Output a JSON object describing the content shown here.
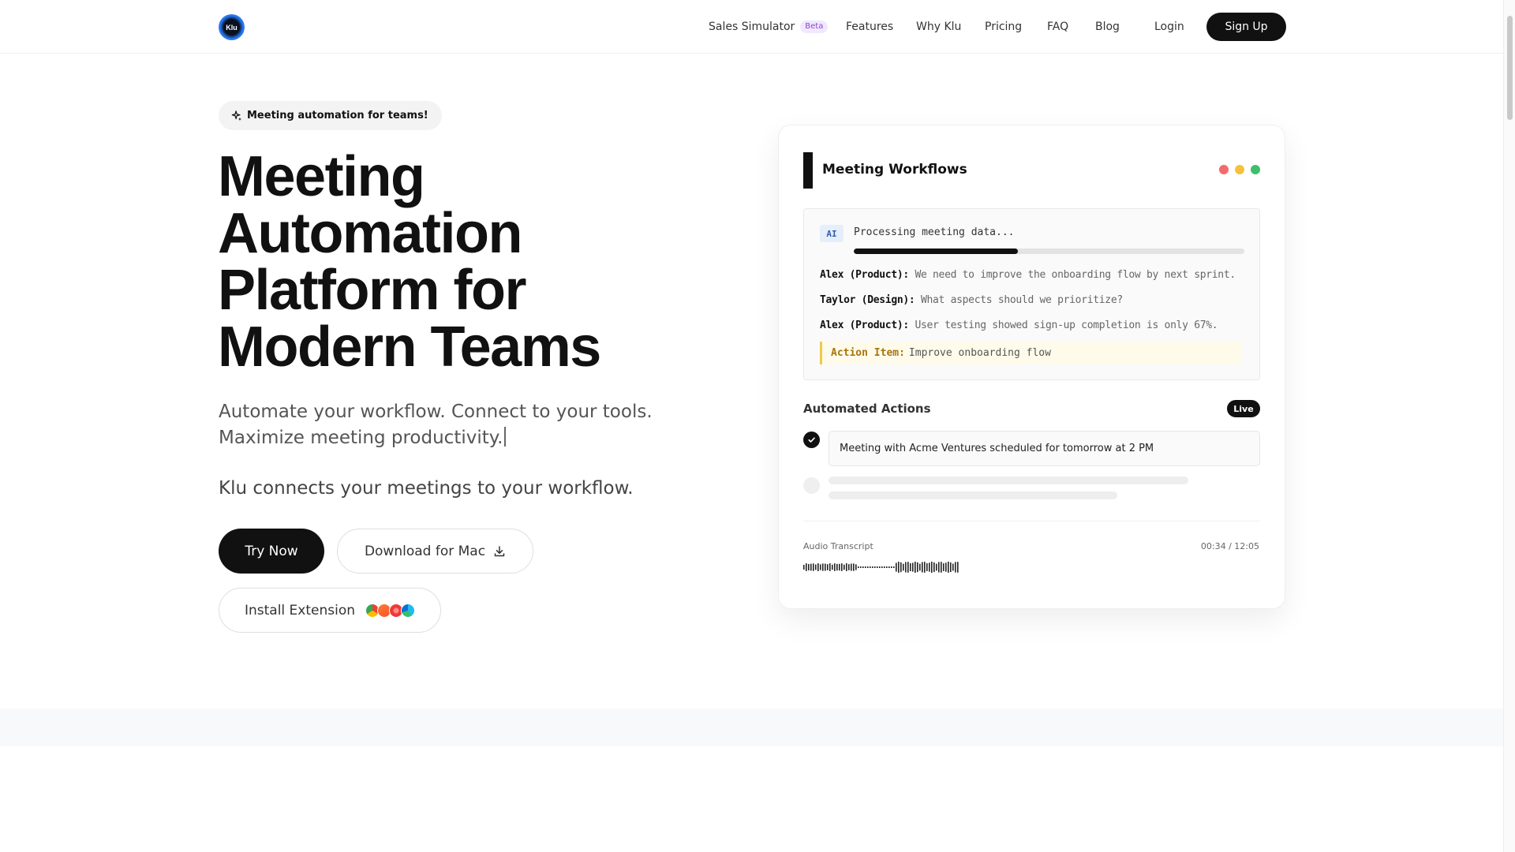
{
  "nav": {
    "logo_text": "Klu",
    "links": [
      {
        "label": "Sales Simulator",
        "badge": "Beta"
      },
      {
        "label": "Features"
      },
      {
        "label": "Why Klu"
      },
      {
        "label": "Pricing"
      },
      {
        "label": "FAQ"
      },
      {
        "label": "Blog"
      }
    ],
    "login": "Login",
    "signup": "Sign Up"
  },
  "hero": {
    "pill": "Meeting automation for teams!",
    "title_lines": [
      "Meeting",
      "Automation",
      "Platform for",
      "Modern Teams"
    ],
    "subtitle_line1": "Automate your workflow. Connect to your tools.",
    "subtitle_line2": "Maximize meeting productivity.",
    "tagline": "Klu connects your meetings to your workflow.",
    "try_now": "Try Now",
    "download_mac": "Download for Mac",
    "install_extension": "Install Extension",
    "browser_icons": [
      "chrome-icon",
      "brave-icon",
      "vivaldi-icon",
      "edge-icon"
    ]
  },
  "card": {
    "title": "Meeting Workflows",
    "window_dots": [
      "#f26b6b",
      "#f5c33b",
      "#3fbf6a"
    ],
    "ai_badge": "AI",
    "processing_text": "Processing meeting data...",
    "processing_progress": 0.42,
    "transcript": [
      {
        "speaker": "Alex (Product):",
        "text": "We need to improve the onboarding flow by next sprint."
      },
      {
        "speaker": "Taylor (Design):",
        "text": "What aspects should we prioritize?"
      },
      {
        "speaker": "Alex (Product):",
        "text": "User testing showed sign-up completion is only 67%."
      }
    ],
    "action_item_label": "Action Item:",
    "action_item_text": "Improve onboarding flow",
    "automated_actions_title": "Automated Actions",
    "live_badge": "Live",
    "event_text": "Meeting with Acme Ventures scheduled for tomorrow at 2 PM",
    "audio_label": "Audio Transcript",
    "audio_time": "00:34 / 12:05"
  }
}
